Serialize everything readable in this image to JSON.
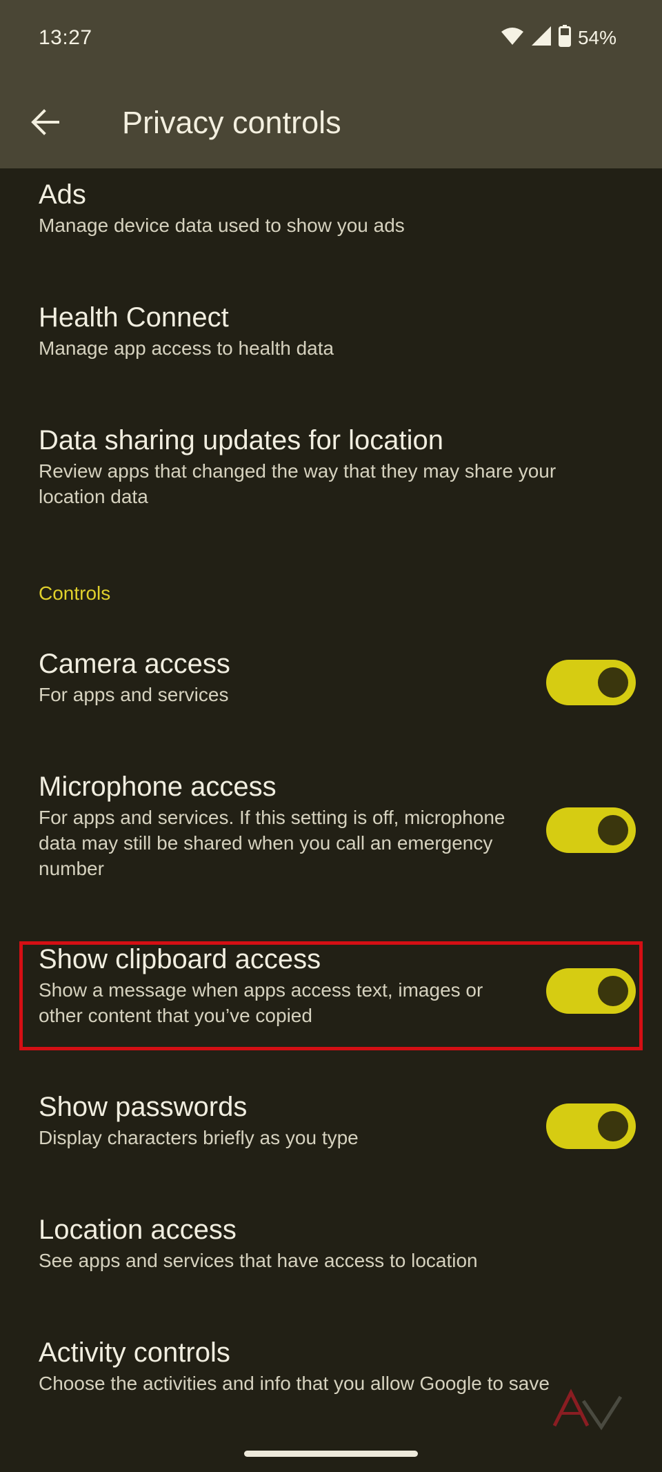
{
  "status": {
    "time": "13:27",
    "battery": "54%"
  },
  "appbar": {
    "title": "Privacy controls"
  },
  "items": {
    "ads": {
      "title": "Ads",
      "summary": "Manage device data used to show you ads"
    },
    "health": {
      "title": "Health Connect",
      "summary": "Manage app access to health data"
    },
    "data_sharing": {
      "title": "Data sharing updates for location",
      "summary": "Review apps that changed the way that they may share your location data"
    },
    "camera": {
      "title": "Camera access",
      "summary": "For apps and services",
      "enabled": true
    },
    "microphone": {
      "title": "Microphone access",
      "summary": "For apps and services. If this setting is off, microphone data may still be shared when you call an emergency number",
      "enabled": true
    },
    "clipboard": {
      "title": "Show clipboard access",
      "summary": "Show a message when apps access text, images or other content that you’ve copied",
      "enabled": true
    },
    "passwords": {
      "title": "Show passwords",
      "summary": "Display characters briefly as you type",
      "enabled": true
    },
    "location": {
      "title": "Location access",
      "summary": "See apps and services that have access to location"
    },
    "activity": {
      "title": "Activity controls",
      "summary": "Choose the activities and info that you allow Google to save"
    }
  },
  "sections": {
    "controls": "Controls"
  },
  "colors": {
    "background": "#222015",
    "appbar": "#4a4635",
    "accent": "#e0d02c",
    "toggle_track": "#d6cc12",
    "highlight": "#d40f14"
  },
  "icons": {
    "back": "arrow-back-icon",
    "wifi": "wifi-icon",
    "signal": "signal-icon",
    "battery": "battery-icon",
    "watermark": "site-logo"
  }
}
